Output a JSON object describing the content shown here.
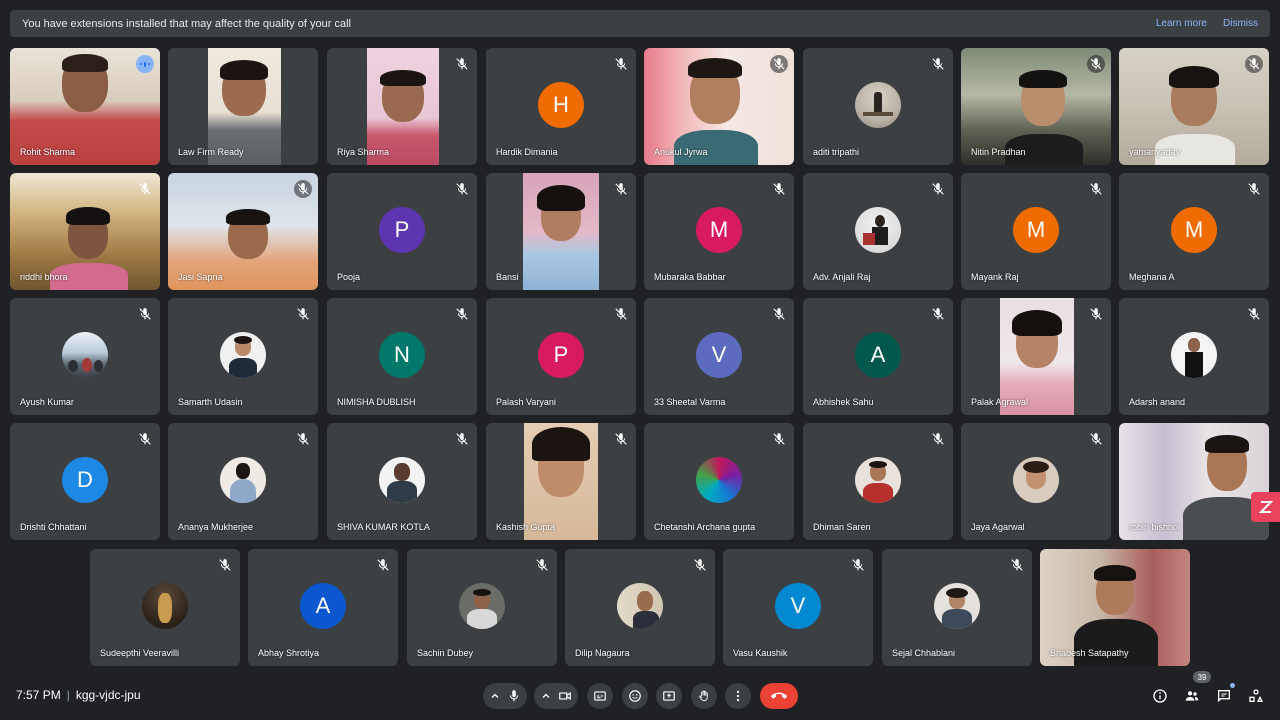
{
  "banner": {
    "message": "You have extensions installed that may affect the quality of your call",
    "learn_more": "Learn more",
    "dismiss": "Dismiss"
  },
  "meeting": {
    "time": "7:57 PM",
    "separator": "|",
    "code": "kgg-vjdc-jpu",
    "participant_count": "39"
  },
  "participants": {
    "p1": "Rohit Sharma",
    "p2": "Law Firm Ready",
    "p3": "Riya Sharma",
    "p4": "Hardik Dimania",
    "p5": "Anukul Jyrwa",
    "p6": "aditi tripathi",
    "p7": "Nitin Pradhan",
    "p8": "yamanyadav",
    "p9": "riddhi bhora",
    "p10": "Jasi Sapna",
    "p11": "Pooja",
    "p12": "Bansi",
    "p13": "Mubaraka Babbar",
    "p14": "Adv. Anjali Raj",
    "p15": "Mayank Raj",
    "p16": "Meghana A",
    "p17": "Ayush Kumar",
    "p18": "Samarth Udasin",
    "p19": "NIMISHA DUBLISH",
    "p20": "Palash Varyani",
    "p21": "33 Sheetal Varma",
    "p22": "Abhishek Sahu",
    "p23": "Palak Agrawal",
    "p24": "Adarsh anand",
    "p25": "Drishti Chhattani",
    "p26": "Ananya Mukherjee",
    "p27": "SHIVA KUMAR KOTLA",
    "p28": "Kashish Gupta",
    "p29": "Chetanshi Archana gupta",
    "p30": "Dhiman Saren",
    "p31": "Jaya Agarwal",
    "p32": "robin bishnoi",
    "p33": "Sudeepthi Veeravilli",
    "p34": "Abhay Shrotiya",
    "p35": "Sachin Dubey",
    "p36": "Dilip Nagaura",
    "p37": "Vasu Kaushik",
    "p38": "Sejal Chhablani",
    "p39": "Bhabesh Satapathy"
  },
  "initials": {
    "hardik": "H",
    "pooja": "P",
    "mubaraka": "M",
    "mayank": "M",
    "meghana": "M",
    "nimisha": "N",
    "palash": "P",
    "sheetal": "V",
    "abhishek": "A",
    "drishti": "D",
    "abhay": "A",
    "vasu": "V"
  },
  "colors": {
    "background": "#202124",
    "tile": "#3c4043",
    "accent": "#8ab4f8",
    "end_call": "#ea4335",
    "orange": "#f06b00",
    "purple": "#5e35b1",
    "pink": "#d81b60",
    "teal": "#00796b",
    "indigo": "#5c6bc0",
    "green_dark": "#00574b",
    "blue": "#1e88e5",
    "blue_dark": "#0b57d0",
    "sky": "#0288d1"
  },
  "icons": {
    "mic_off": "mic-off-icon",
    "mic": "mic-icon",
    "camera": "camera-icon",
    "captions": "captions-icon",
    "emoji": "emoji-icon",
    "present": "present-icon",
    "raise_hand": "raise-hand-icon",
    "more": "more-options-icon",
    "end_call": "end-call-icon",
    "info": "info-icon",
    "people": "people-icon",
    "chat": "chat-icon",
    "activities": "activities-icon"
  }
}
